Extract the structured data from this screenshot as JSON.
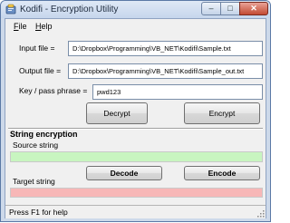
{
  "window": {
    "title": "Kodifi - Encryption Utility",
    "caption_buttons": {
      "minimize": "–",
      "maximize": "□",
      "close": "✕"
    }
  },
  "menu": {
    "file_underline": "F",
    "file_rest": "ile",
    "help_underline": "H",
    "help_rest": "elp"
  },
  "form": {
    "input_label": "Input file =",
    "input_value": "D:\\Dropbox\\Programming\\VB_NET\\Kodifi\\Sample.txt",
    "output_label": "Output file =",
    "output_value": "D:\\Dropbox\\Programming\\VB_NET\\Kodifi\\Sample_out.txt",
    "key_label": "Key / pass phrase =",
    "key_value": "pwd123",
    "decrypt_label": "Decrypt",
    "encrypt_label": "Encrypt"
  },
  "string_section": {
    "title": "String encryption",
    "source_label": "Source string",
    "source_value": "",
    "decode_label": "Decode",
    "encode_label": "Encode",
    "target_label": "Target string",
    "target_value": ""
  },
  "status": {
    "text": "Press F1 for help"
  },
  "colors": {
    "source_bg": "#c8f5c0",
    "target_bg": "#f7b7b7",
    "window_frame": "#cdd9ea",
    "close_button": "#c34a32"
  },
  "icons": {
    "app": "app-icon",
    "grip": "size-grip-icon"
  }
}
